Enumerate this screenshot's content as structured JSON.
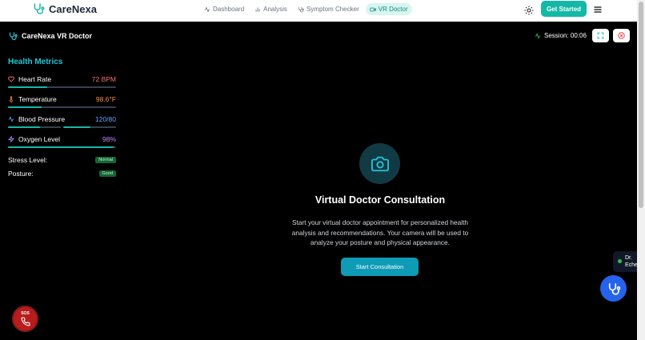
{
  "app": {
    "brand": "CareNexa"
  },
  "nav": {
    "items": [
      {
        "label": "Dashboard",
        "icon": "activity-icon",
        "active": false
      },
      {
        "label": "Analysis",
        "icon": "bar-chart-icon",
        "active": false
      },
      {
        "label": "Symptom Checker",
        "icon": "stethoscope-icon",
        "active": false
      },
      {
        "label": "VR Doctor",
        "icon": "video-icon",
        "active": true
      }
    ],
    "cta": "Get Started"
  },
  "vr": {
    "title": "CareNexa VR Doctor",
    "session_label": "Session: 00:06"
  },
  "metrics": {
    "title": "Health Metrics",
    "items": [
      {
        "label": "Heart Rate",
        "value": "72 BPM",
        "icon": "heart-icon",
        "color": "#f87171",
        "fill": 0.36
      },
      {
        "label": "Temperature",
        "value": "98.6°F",
        "icon": "thermometer-icon",
        "color": "#fb923c",
        "fill": 0.31
      },
      {
        "label": "Blood Pressure",
        "value": "120/80",
        "icon": "activity-icon",
        "color": "#60a5fa",
        "fill_a": 0.6,
        "fill_b": 0.52
      },
      {
        "label": "Oxygen Level",
        "value": "98%",
        "icon": "zap-icon",
        "color": "#c084fc",
        "fill": 0.98
      }
    ],
    "stress": {
      "label": "Stress Level:",
      "value": "Normal"
    },
    "posture": {
      "label": "Posture:",
      "value": "Good"
    }
  },
  "consult": {
    "title": "Virtual Doctor Consultation",
    "description": "Start your virtual doctor appointment for personalized health analysis and recommendations. Your camera will be used to analyze your posture and physical appearance.",
    "button": "Start Consultation"
  },
  "sos": {
    "label": "SOS"
  },
  "doctor_chip": {
    "line1": "Dr.",
    "line2": "Eche"
  },
  "colors": {
    "accent": "#14b8a6",
    "teal_title": "#22c5d9",
    "fab": "#2563eb",
    "sos": "#b91c1c"
  }
}
